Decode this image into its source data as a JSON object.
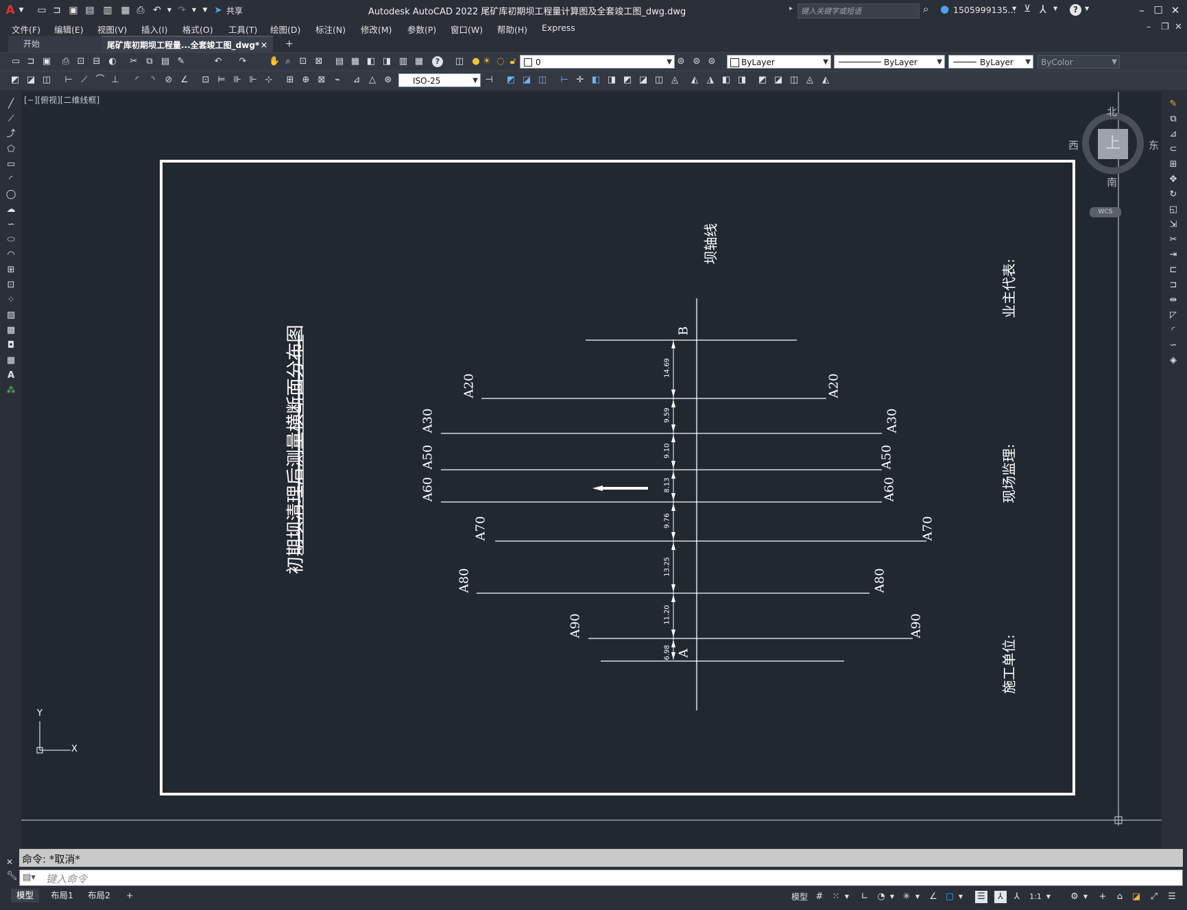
{
  "app": {
    "logo": "A",
    "share_label": "共享",
    "title": "Autodesk AutoCAD 2022    尾矿库初期坝工程量计算图及全套竣工图_dwg.dwg",
    "search_placeholder": "键入关键字或短语",
    "user": "1505999135...",
    "help_icon": "?"
  },
  "menu": [
    "文件(F)",
    "编辑(E)",
    "视图(V)",
    "插入(I)",
    "格式(O)",
    "工具(T)",
    "绘图(D)",
    "标注(N)",
    "修改(M)",
    "参数(P)",
    "窗口(W)",
    "帮助(H)",
    "Express"
  ],
  "tabs": {
    "start": "开始",
    "active": "尾矿库初期坝工程量...全套竣工图_dwg*",
    "close": "✕",
    "add": "+"
  },
  "toolbar": {
    "layer_value": "0",
    "color_value": "ByLayer",
    "linetype_value": "ByLayer",
    "lineweight_value": "ByLayer",
    "plotstyle_value": "ByColor",
    "dimstyle_value": "ISO-25"
  },
  "viewport_label": "[−][俯视][二维线框]",
  "viewcube": {
    "north": "北",
    "south": "南",
    "east": "东",
    "west": "西",
    "face": "上",
    "wcs": "WCS"
  },
  "drawing": {
    "title": "初期坝清理后测量横断面分布图",
    "axis_label": "坝轴线",
    "owner_label": "业主代表:",
    "supervisor_label": "现场监理:",
    "contractor_label": "施工单位:",
    "point_a": "A",
    "point_b": "B",
    "sections": [
      {
        "name": "A20",
        "dim": "14.69"
      },
      {
        "name": "A30",
        "dim": "9.59"
      },
      {
        "name": "A50",
        "dim": "9.10"
      },
      {
        "name": "A60",
        "dim": "8.13"
      },
      {
        "name": "A70",
        "dim": "9.76"
      },
      {
        "name": "A80",
        "dim": "13.25"
      },
      {
        "name": "A90",
        "dim": "11.20"
      },
      {
        "name": "A",
        "dim": "6.98"
      }
    ],
    "ucs_x": "X",
    "ucs_y": "Y"
  },
  "command": {
    "history": "命令:  *取消*",
    "placeholder": "键入命令"
  },
  "status": {
    "layouts": [
      "模型",
      "布局1",
      "布局2"
    ],
    "add_layout": "+",
    "model_button": "模型",
    "scale": "1:1"
  }
}
